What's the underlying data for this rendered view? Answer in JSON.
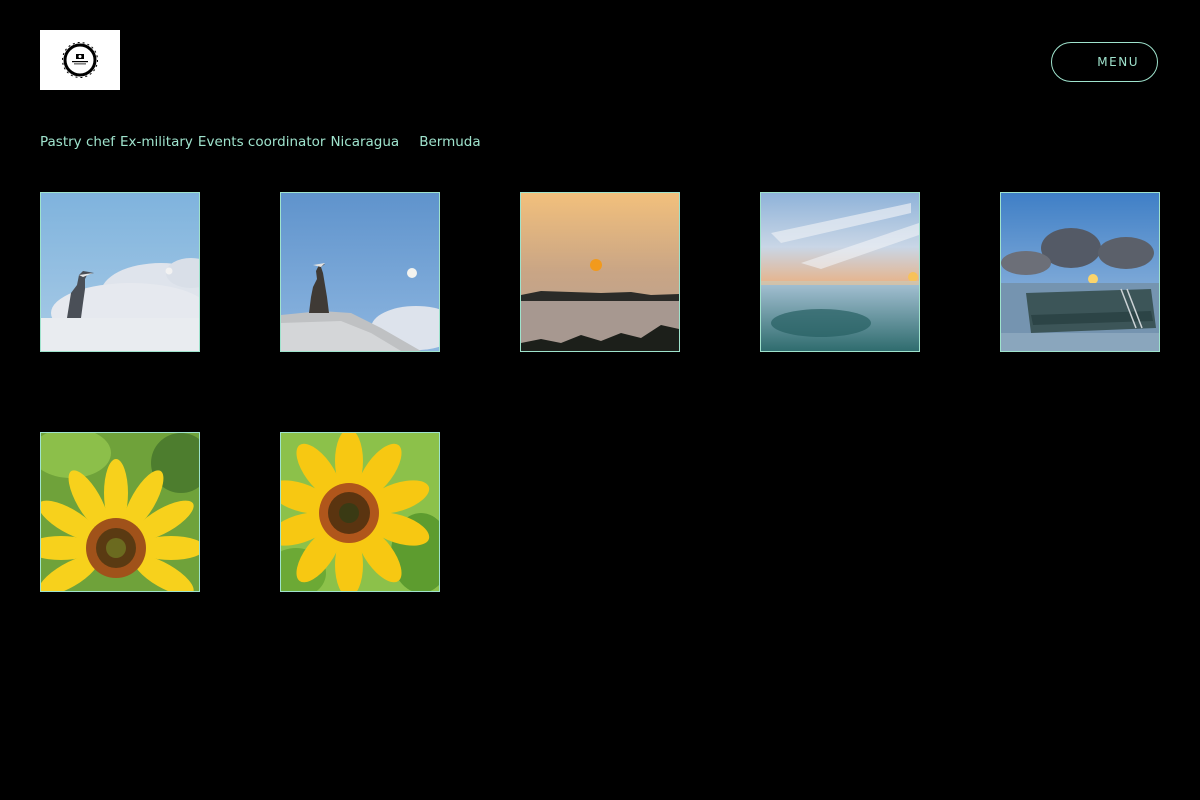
{
  "header": {
    "menu_label": "MENU"
  },
  "tags": [
    "Pastry chef",
    "Ex-military",
    "Events coordinator",
    "Nicaragua",
    "Bermuda"
  ],
  "gallery": {
    "items": [
      {
        "subject": "heron-against-clouds"
      },
      {
        "subject": "heron-with-moon"
      },
      {
        "subject": "sunset-over-water"
      },
      {
        "subject": "reflective-sea-sunrise"
      },
      {
        "subject": "shipwreck-at-sunrise"
      },
      {
        "subject": "sunflower-closeup"
      },
      {
        "subject": "sunflower-closeup"
      }
    ]
  },
  "colors": {
    "background": "#000000",
    "accent": "#9fe3cd",
    "logo_bg": "#ffffff"
  }
}
